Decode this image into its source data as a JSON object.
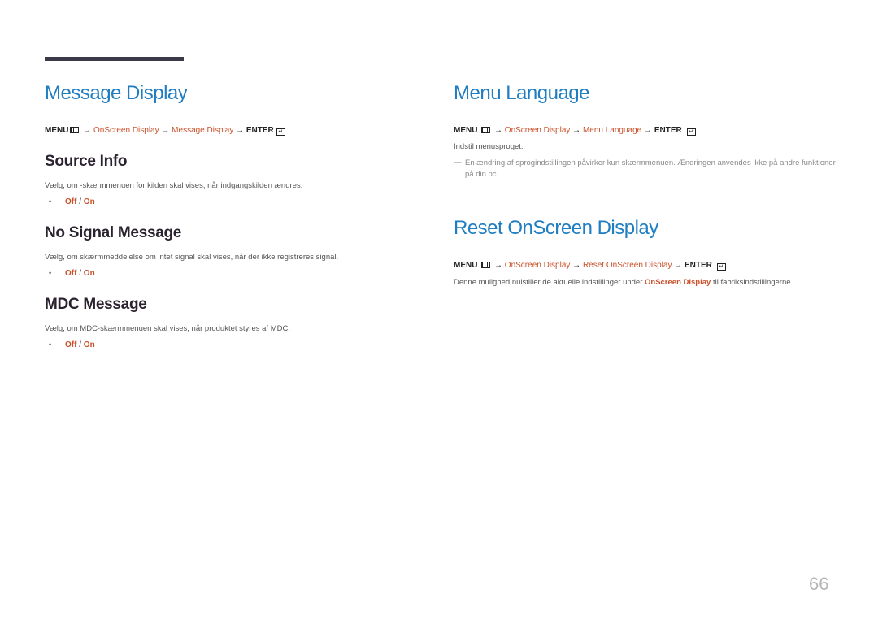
{
  "left": {
    "title": "Message Display",
    "path": {
      "menu": "MENU",
      "arrow": " → ",
      "step1": "OnScreen Display",
      "step2": "Message Display",
      "enter": "ENTER"
    },
    "sections": [
      {
        "title": "Source Info",
        "desc": "Vælg, om -skærmmenuen for kilden skal vises, når indgangskilden ændres.",
        "opt_off": "Off",
        "opt_sep": " / ",
        "opt_on": "On"
      },
      {
        "title": "No Signal Message",
        "desc": "Vælg, om skærmmeddelelse om intet signal skal vises, når der ikke registreres signal.",
        "opt_off": "Off",
        "opt_sep": " / ",
        "opt_on": "On"
      },
      {
        "title": "MDC Message",
        "desc": "Vælg, om MDC-skærmmenuen skal vises, når produktet styres af MDC.",
        "opt_off": "Off",
        "opt_sep": " / ",
        "opt_on": "On"
      }
    ]
  },
  "right": {
    "menu_language": {
      "title": "Menu Language",
      "path": {
        "menu": "MENU",
        "arrow": " → ",
        "step1": "OnScreen Display",
        "step2": "Menu Language",
        "enter": "ENTER"
      },
      "desc": "Indstil menusproget.",
      "note_mark": "―",
      "note": "En ændring af sprogindstillingen påvirker kun skærmmenuen. Ændringen anvendes ikke på andre funktioner på din pc."
    },
    "reset": {
      "title": "Reset OnScreen Display",
      "path": {
        "menu": "MENU",
        "arrow": " → ",
        "step1": "OnScreen Display",
        "step2": "Reset OnScreen Display",
        "enter": "ENTER"
      },
      "desc_before": "Denne mulighed nulstiller de aktuelle indstillinger under ",
      "desc_highlight": "OnScreen Display",
      "desc_after": " til fabriksindstillingerne."
    }
  },
  "page_number": "66",
  "bullet": "•"
}
